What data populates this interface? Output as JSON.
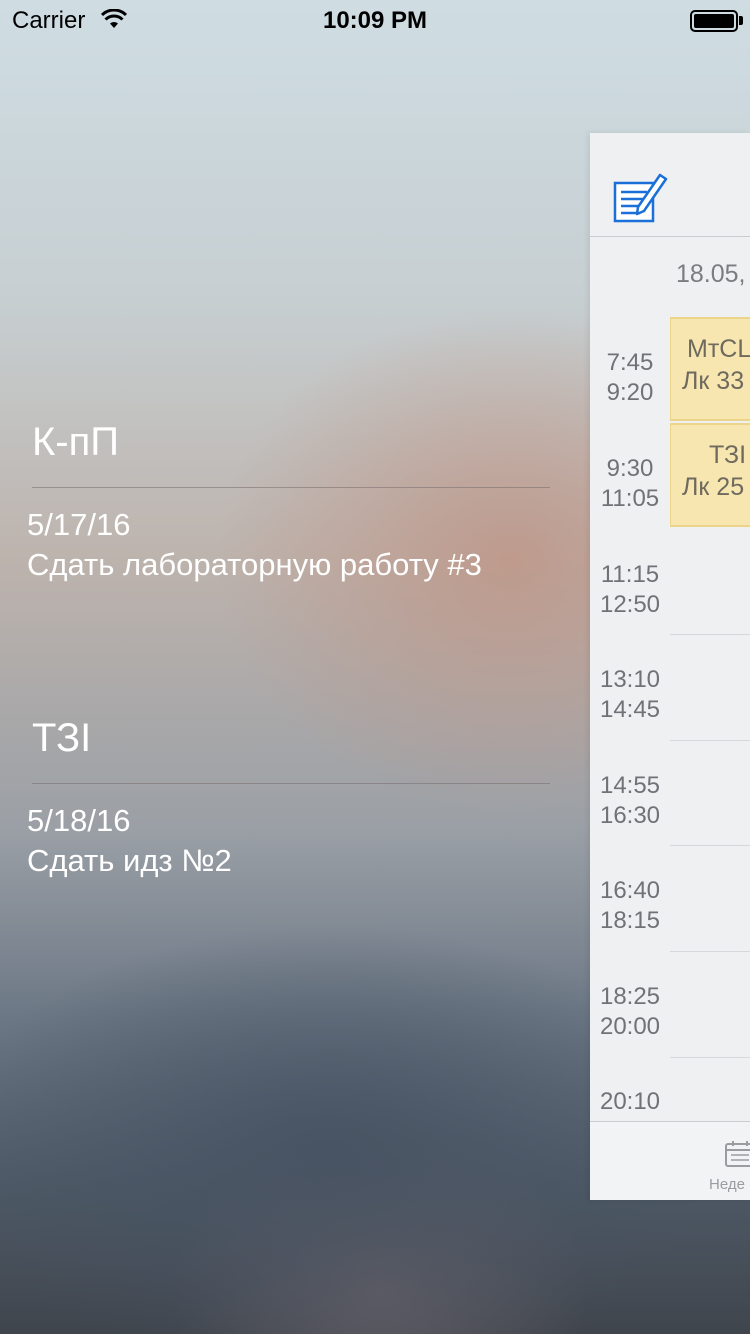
{
  "status_bar": {
    "carrier": "Carrier",
    "time": "10:09 PM",
    "wifi_icon": "wifi-icon",
    "battery_icon": "battery-icon"
  },
  "menu": {
    "tasks": [
      {
        "title": "К-пП",
        "date": "5/17/16",
        "description": "Сдать лабораторную работу #3"
      },
      {
        "title": "ТЗІ",
        "date": "5/18/16",
        "description": "Сдать идз №2"
      }
    ]
  },
  "schedule": {
    "edit_icon": "edit-notes-icon",
    "date_header": "18.05,",
    "time_slots": [
      {
        "start": "7:45",
        "end": "9:20"
      },
      {
        "start": "9:30",
        "end": "11:05"
      },
      {
        "start": "11:15",
        "end": "12:50"
      },
      {
        "start": "13:10",
        "end": "14:45"
      },
      {
        "start": "14:55",
        "end": "16:30"
      },
      {
        "start": "16:40",
        "end": "18:15"
      },
      {
        "start": "18:25",
        "end": "20:00"
      },
      {
        "start": "20:10",
        "end": ""
      }
    ],
    "lessons": [
      {
        "name": "МтСL",
        "room": "Лк 33"
      },
      {
        "name": "ТЗІ",
        "room": "Лк 25"
      }
    ],
    "tab": {
      "label": "Неде",
      "icon": "calendar-week-icon"
    },
    "colors": {
      "lesson_bg": "#f7e6b0",
      "lesson_border": "#ecd58a",
      "panel_bg": "#eef0f2"
    }
  }
}
